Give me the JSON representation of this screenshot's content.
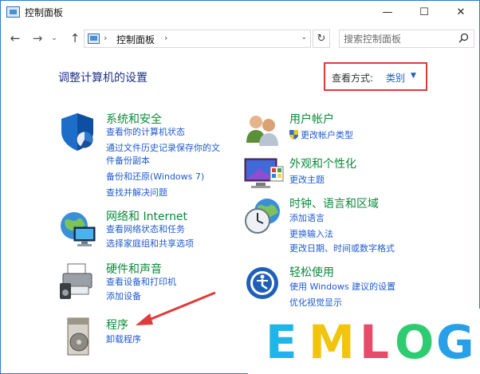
{
  "window": {
    "title": "控制面板",
    "minimize_glyph": "—",
    "maximize_glyph": "☐",
    "close_glyph": "✕"
  },
  "nav": {
    "back_glyph": "←",
    "forward_glyph": "→",
    "recent_glyph": "⌄",
    "up_glyph": "↑",
    "breadcrumb": [
      "控制面板"
    ],
    "refresh_glyph": "↻",
    "search_placeholder": "搜索控制面板"
  },
  "header": {
    "title": "调整计算机的设置",
    "view_by_label": "查看方式:",
    "view_by_value": "类别"
  },
  "categories": {
    "system_security": {
      "title": "系统和安全",
      "links": [
        "查看你的计算机状态",
        "通过文件历史记录保存你的文",
        "件备份副本",
        "备份和还原(Windows 7)",
        "查找并解决问题"
      ]
    },
    "network": {
      "title": "网络和 Internet",
      "links": [
        "查看网络状态和任务",
        "选择家庭组和共享选项"
      ]
    },
    "hardware": {
      "title": "硬件和声音",
      "links": [
        "查看设备和打印机",
        "添加设备"
      ]
    },
    "programs": {
      "title": "程序",
      "links": [
        "卸载程序"
      ]
    },
    "user_accounts": {
      "title": "用户帐户",
      "links": [
        "更改帐户类型"
      ]
    },
    "appearance": {
      "title": "外观和个性化",
      "links": [
        "更改主题"
      ]
    },
    "clock_region": {
      "title": "时钟、语言和区域",
      "links": [
        "添加语言",
        "更换输入法",
        "更改日期、时间或数字格式"
      ]
    },
    "ease_access": {
      "title": "轻松使用",
      "links": [
        "使用 Windows 建议的设置",
        "优化视觉显示"
      ]
    }
  },
  "watermark": {
    "letters": [
      "E",
      "M",
      "L",
      "O",
      "G"
    ],
    "colors": [
      "#1fb5e8",
      "#f1c40f",
      "#e84a6a",
      "#2ecc71",
      "#27a0e8"
    ]
  },
  "colors": {
    "link": "#1e5ad2",
    "category_title": "#0a8a3a",
    "heading": "#1e3287",
    "highlight_box": "#e03b3b",
    "arrow": "#e03b3b"
  }
}
